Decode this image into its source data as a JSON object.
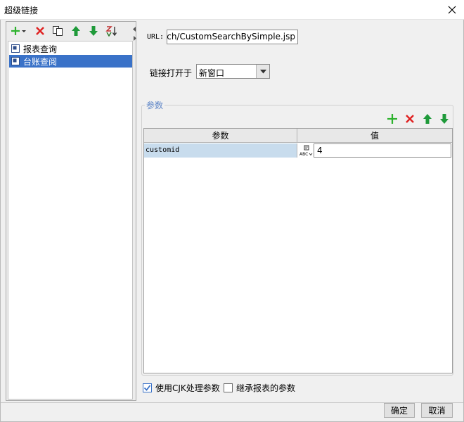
{
  "window": {
    "title": "超级链接"
  },
  "left_toolbar": {
    "icons": [
      "add-dropdown-icon",
      "delete-icon",
      "copy-icon",
      "move-up-icon",
      "move-down-icon",
      "sort-icon"
    ]
  },
  "tree": {
    "items": [
      {
        "label": "报表查询",
        "selected": false
      },
      {
        "label": "台账查阅",
        "selected": true
      }
    ]
  },
  "url": {
    "label": "URL:",
    "value": "/datas/CustomSearch/CustomSearchBySimple.jsp"
  },
  "open_in": {
    "label": "链接打开于",
    "value": "新窗口"
  },
  "params": {
    "group_title": "参数",
    "columns": [
      "参数",
      "值"
    ],
    "rows": [
      {
        "name": "customid",
        "value": "4"
      }
    ]
  },
  "options": {
    "use_cjk": {
      "label": "使用CJK处理参数",
      "checked": true
    },
    "inherit": {
      "label": "继承报表的参数",
      "checked": false
    }
  },
  "buttons": {
    "ok": "确定",
    "cancel": "取消"
  },
  "colors": {
    "add": "#2db22d",
    "delete": "#e02020",
    "arrow": "#1f9a3a",
    "selection": "#3a72c8"
  }
}
